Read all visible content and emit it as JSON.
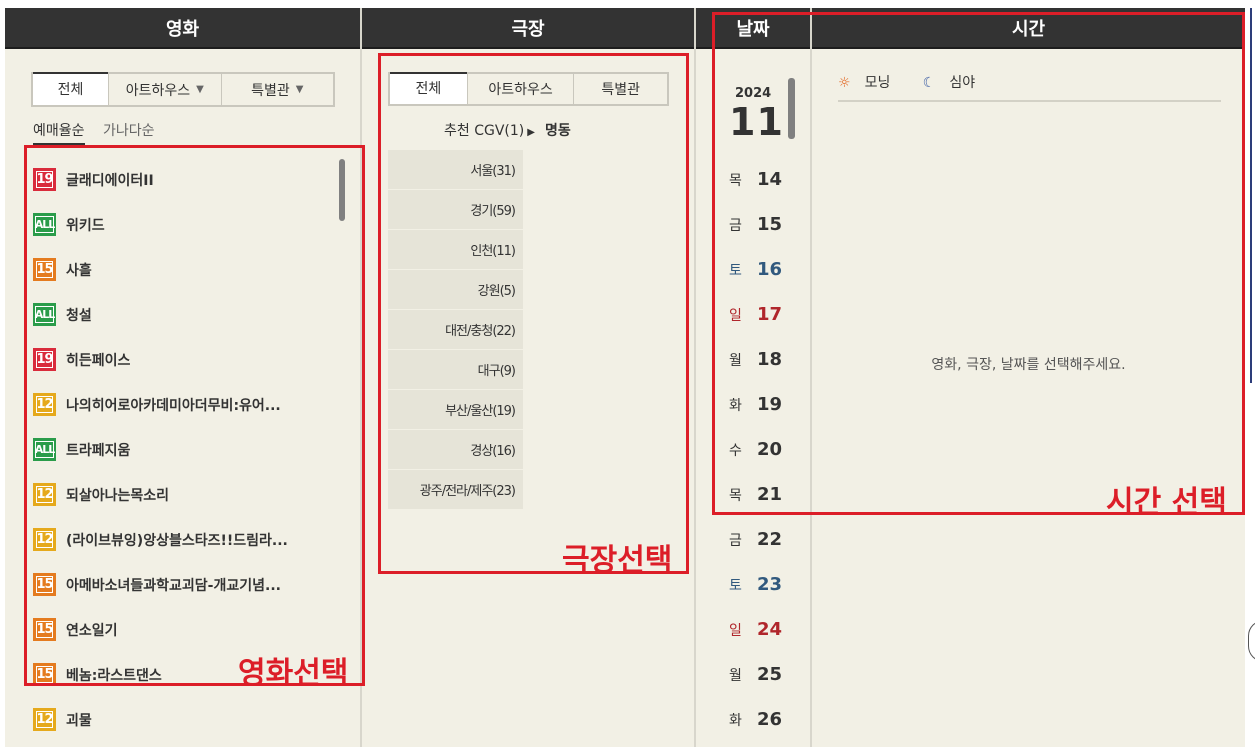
{
  "columns": {
    "movie": "영화",
    "theater": "극장",
    "date": "날짜",
    "time": "시간"
  },
  "movie_tabs": [
    {
      "label": "전체"
    },
    {
      "label": "아트하우스"
    },
    {
      "label": "특별관"
    }
  ],
  "sort": {
    "booking": "예매율순",
    "alpha": "가나다순"
  },
  "movies": [
    {
      "rating": "19",
      "title": "글래디에이터II"
    },
    {
      "rating": "ALL",
      "title": "위키드"
    },
    {
      "rating": "15",
      "title": "사흘"
    },
    {
      "rating": "ALL",
      "title": "청설"
    },
    {
      "rating": "19",
      "title": "히든페이스"
    },
    {
      "rating": "12",
      "title": "나의히어로아카데미아더무비:유어..."
    },
    {
      "rating": "ALL",
      "title": "트라페지움"
    },
    {
      "rating": "12",
      "title": "되살아나는목소리"
    },
    {
      "rating": "12",
      "title": "(라이브뷰잉)앙상블스타즈!!드림라..."
    },
    {
      "rating": "15",
      "title": "아메바소녀들과학교괴담-개교기념..."
    },
    {
      "rating": "15",
      "title": "연소일기"
    },
    {
      "rating": "15",
      "title": "베놈:라스트댄스"
    },
    {
      "rating": "12",
      "title": "괴물"
    }
  ],
  "theater_tabs": [
    {
      "label": "전체"
    },
    {
      "label": "아트하우스"
    },
    {
      "label": "특별관"
    }
  ],
  "theater_reco": {
    "label": "추천 CGV(1)",
    "name": "명동"
  },
  "regions": [
    "서울(31)",
    "경기(59)",
    "인천(11)",
    "강원(5)",
    "대전/충청(22)",
    "대구(9)",
    "부산/울산(19)",
    "경상(16)",
    "광주/전라/제주(23)"
  ],
  "calendar": {
    "year": "2024",
    "month": "11",
    "days": [
      {
        "dow": "목",
        "day": "14",
        "type": "weekday"
      },
      {
        "dow": "금",
        "day": "15",
        "type": "weekday"
      },
      {
        "dow": "토",
        "day": "16",
        "type": "sat"
      },
      {
        "dow": "일",
        "day": "17",
        "type": "sun"
      },
      {
        "dow": "월",
        "day": "18",
        "type": "weekday"
      },
      {
        "dow": "화",
        "day": "19",
        "type": "weekday"
      },
      {
        "dow": "수",
        "day": "20",
        "type": "weekday"
      },
      {
        "dow": "목",
        "day": "21",
        "type": "weekday"
      },
      {
        "dow": "금",
        "day": "22",
        "type": "weekday"
      },
      {
        "dow": "토",
        "day": "23",
        "type": "sat"
      },
      {
        "dow": "일",
        "day": "24",
        "type": "sun"
      },
      {
        "dow": "월",
        "day": "25",
        "type": "weekday"
      },
      {
        "dow": "화",
        "day": "26",
        "type": "weekday"
      }
    ]
  },
  "time_legend": {
    "morning": "모닝",
    "night": "심야"
  },
  "time_message": "영화, 극장, 날짜를 선택해주세요.",
  "annotations": {
    "movie": "영화선택",
    "theater": "극장선택",
    "time": "시간 선택"
  },
  "colors": {
    "annotation_red": "#dc1e28",
    "header_bg": "#333333",
    "panel_bg": "#f2f0e5",
    "rating_19": "#d92b3b",
    "rating_15": "#e47b1f",
    "rating_12": "#e5a91c",
    "rating_all": "#2a9c4a",
    "saturday": "#31597e",
    "sunday": "#b0262b"
  }
}
